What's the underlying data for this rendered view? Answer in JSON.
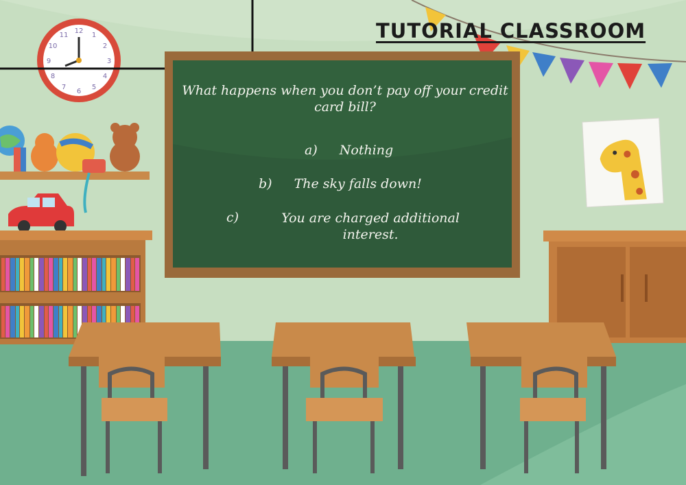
{
  "page": {
    "title": "TUTORIAL CLASSROOM"
  },
  "quiz": {
    "question": "What happens when you don’t pay off your credit card bill?",
    "options": [
      {
        "letter": "a)",
        "text": "Nothing"
      },
      {
        "letter": "b)",
        "text": "The sky falls down!"
      },
      {
        "letter": "c)",
        "text": "You are charged additional interest."
      }
    ]
  },
  "clock": {
    "numbers": [
      "12",
      "1",
      "2",
      "3",
      "4",
      "5",
      "6",
      "7",
      "8",
      "9",
      "10",
      "11"
    ]
  },
  "colors": {
    "chalkboard": "#2f5a3a",
    "board_frame": "#9a6a3b",
    "wall": "#cfe3c9",
    "floor": "#6fb08e"
  }
}
